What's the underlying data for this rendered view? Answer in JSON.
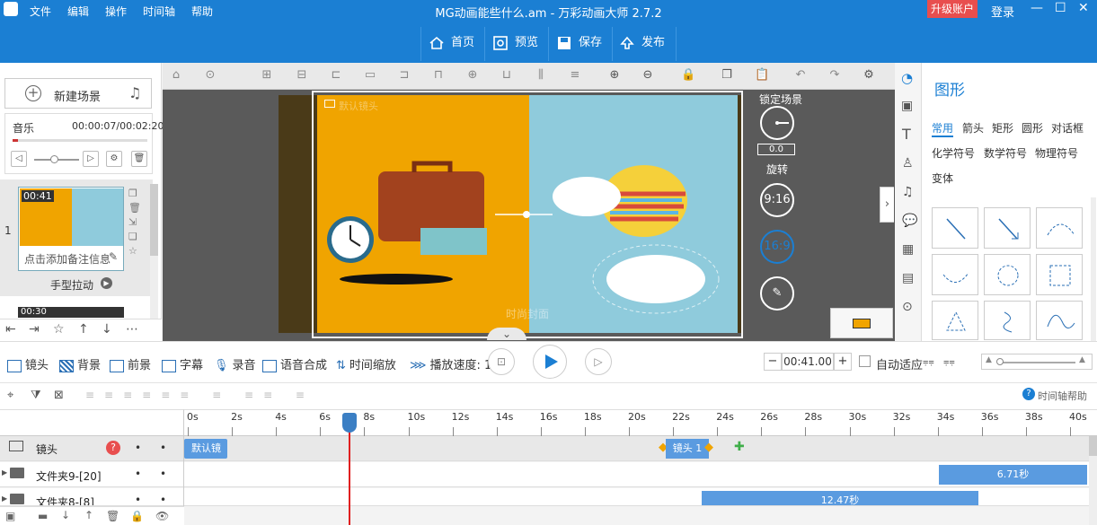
{
  "menu": {
    "file": "文件",
    "edit": "编辑",
    "action": "操作",
    "timeline": "时间轴",
    "help": "帮助"
  },
  "title": "MG动画能些什么.am - 万彩动画大师 2.7.2",
  "upgrade": "升级账户",
  "login": "登录",
  "toolbar": {
    "home": "首页",
    "preview": "预览",
    "save": "保存",
    "publish": "发布"
  },
  "left": {
    "new_scene": "新建场景",
    "music_label": "音乐",
    "music_time": "00:00:07/00:02:20",
    "scene_number": "1",
    "scene_duration": "00:41",
    "scene_note": "点击添加备注信息",
    "transition": "手型拉动",
    "next_scene_duration": "00:30"
  },
  "canvas": {
    "camera_label": "默认镜头",
    "watermark": "时尚封面",
    "lock_scene": "锁定场景",
    "rotate_value": "0.0",
    "rotate_label": "旋转",
    "ratio1": "9:16",
    "ratio2": "16:9"
  },
  "right": {
    "title": "图形",
    "tabs": [
      "常用",
      "箭头",
      "矩形",
      "圆形",
      "对话框",
      "化学符号",
      "数学符号",
      "物理符号",
      "变体"
    ]
  },
  "bottom": {
    "camera": "镜头",
    "background": "背景",
    "foreground": "前景",
    "subtitle": "字幕",
    "record": "录音",
    "tts": "语音合成",
    "timescale": "时间缩放",
    "speed": "播放速度: 1.",
    "time": "00:41.00",
    "auto_fit": "自动适应"
  },
  "timeline": {
    "help": "时间轴帮助",
    "ticks": [
      "0s",
      "2s",
      "4s",
      "6s",
      "8s",
      "10s",
      "12s",
      "14s",
      "16s",
      "18s",
      "20s",
      "22s",
      "24s",
      "26s",
      "28s",
      "30s",
      "32s",
      "34s",
      "36s",
      "38s",
      "40s"
    ],
    "tracks": [
      {
        "name": "镜头",
        "blocks": [
          {
            "label": "默认镜"
          },
          {
            "label": "镜头 1"
          }
        ]
      },
      {
        "name": "文件夹9-[20]",
        "blocks": [
          {
            "label": "6.71秒"
          }
        ]
      },
      {
        "name": "文件夹8-[8]",
        "blocks": [
          {
            "label": "12.47秒"
          }
        ]
      }
    ]
  },
  "colors": {
    "brand": "#1b7fd3",
    "upgrade": "#e84e4e",
    "block": "#5a9be0",
    "playhead": "#e02020"
  }
}
